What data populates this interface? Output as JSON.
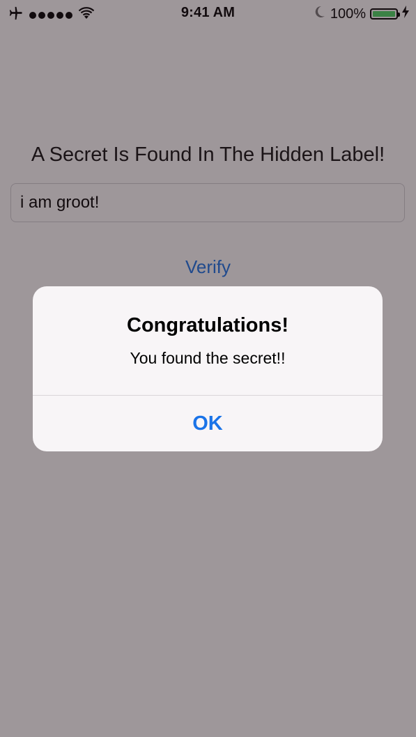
{
  "status_bar": {
    "time": "9:41 AM",
    "battery_percent": "100%",
    "battery_level": 1.0,
    "battery_color": "#4cd964",
    "icons": [
      "airplane-icon",
      "signal-icon",
      "wifi-icon",
      "moon-icon",
      "battery-icon",
      "charging-icon"
    ]
  },
  "main": {
    "hidden_label": "A Secret Is Found In The Hidden Label!",
    "input_value": "i am groot!",
    "verify_label": "Verify"
  },
  "alert": {
    "title": "Congratulations!",
    "message": "You found the secret!!",
    "ok_label": "OK"
  },
  "colors": {
    "accent": "#1a73e8"
  }
}
